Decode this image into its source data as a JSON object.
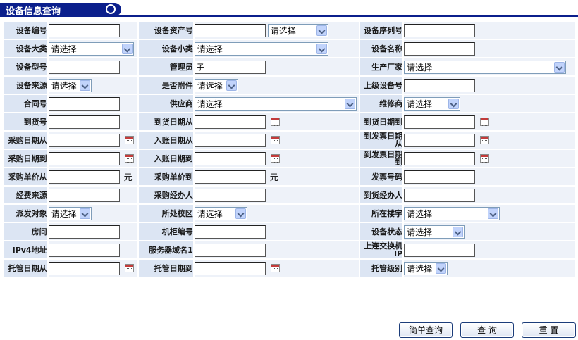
{
  "header": {
    "title": "设备信息查询"
  },
  "select_default": "请选择",
  "rows": [
    [
      {
        "label": "设备编号",
        "type": "input",
        "value": ""
      },
      {
        "label": "设备资产号",
        "type": "input_select",
        "value": "",
        "select": "请选择"
      },
      {
        "label": "设备序列号",
        "type": "input",
        "value": ""
      }
    ],
    [
      {
        "label": "设备大类",
        "type": "select",
        "value": "请选择"
      },
      {
        "label": "设备小类",
        "type": "select",
        "value": "请选择"
      },
      {
        "label": "设备名称",
        "type": "input",
        "value": ""
      }
    ],
    [
      {
        "label": "设备型号",
        "type": "input",
        "value": ""
      },
      {
        "label": "管理员",
        "type": "input",
        "value": "子"
      },
      {
        "label": "生产厂家",
        "type": "select",
        "value": "请选择"
      }
    ],
    [
      {
        "label": "设备来源",
        "type": "select",
        "value": "请选择"
      },
      {
        "label": "是否附件",
        "type": "select",
        "value": "请选择"
      },
      {
        "label": "上级设备号",
        "type": "input",
        "value": ""
      }
    ],
    [
      {
        "label": "合同号",
        "type": "input",
        "value": ""
      },
      {
        "label": "供应商",
        "type": "select",
        "value": "请选择"
      },
      {
        "label": "维修商",
        "type": "select",
        "value": "请选择"
      }
    ],
    [
      {
        "label": "到货号",
        "type": "input",
        "value": ""
      },
      {
        "label": "到货日期从",
        "type": "date",
        "value": ""
      },
      {
        "label": "到货日期到",
        "type": "date",
        "value": ""
      }
    ],
    [
      {
        "label": "采购日期从",
        "type": "date",
        "value": ""
      },
      {
        "label": "入账日期从",
        "type": "date",
        "value": ""
      },
      {
        "label": "到发票日期从",
        "type": "date",
        "value": ""
      }
    ],
    [
      {
        "label": "采购日期到",
        "type": "date",
        "value": ""
      },
      {
        "label": "入账日期到",
        "type": "date",
        "value": ""
      },
      {
        "label": "到发票日期到",
        "type": "date",
        "value": ""
      }
    ],
    [
      {
        "label": "采购单价从",
        "type": "price",
        "value": "",
        "unit": "元"
      },
      {
        "label": "采购单价到",
        "type": "price",
        "value": "",
        "unit": "元"
      },
      {
        "label": "发票号码",
        "type": "input",
        "value": ""
      }
    ],
    [
      {
        "label": "经费来源",
        "type": "input",
        "value": ""
      },
      {
        "label": "采购经办人",
        "type": "input",
        "value": ""
      },
      {
        "label": "到货经办人",
        "type": "input",
        "value": ""
      }
    ],
    [
      {
        "label": "派发对象",
        "type": "select",
        "value": "请选择"
      },
      {
        "label": "所处校区",
        "type": "select",
        "value": "请选择"
      },
      {
        "label": "所在楼宇",
        "type": "select",
        "value": "请选择"
      }
    ],
    [
      {
        "label": "房间",
        "type": "input",
        "value": ""
      },
      {
        "label": "机柜编号",
        "type": "input",
        "value": ""
      },
      {
        "label": "设备状态",
        "type": "select",
        "value": "请选择"
      }
    ],
    [
      {
        "label": "IPv4地址",
        "type": "input",
        "value": ""
      },
      {
        "label": "服务器域名1",
        "type": "input",
        "value": ""
      },
      {
        "label": "上连交换机IP",
        "type": "input",
        "value": ""
      }
    ],
    [
      {
        "label": "托管日期从",
        "type": "date",
        "value": ""
      },
      {
        "label": "托管日期到",
        "type": "date",
        "value": ""
      },
      {
        "label": "托管级别",
        "type": "select",
        "value": "请选择"
      }
    ]
  ],
  "buttons": {
    "simple_query": "简单查询",
    "query": "查 询",
    "reset": "重 置"
  }
}
